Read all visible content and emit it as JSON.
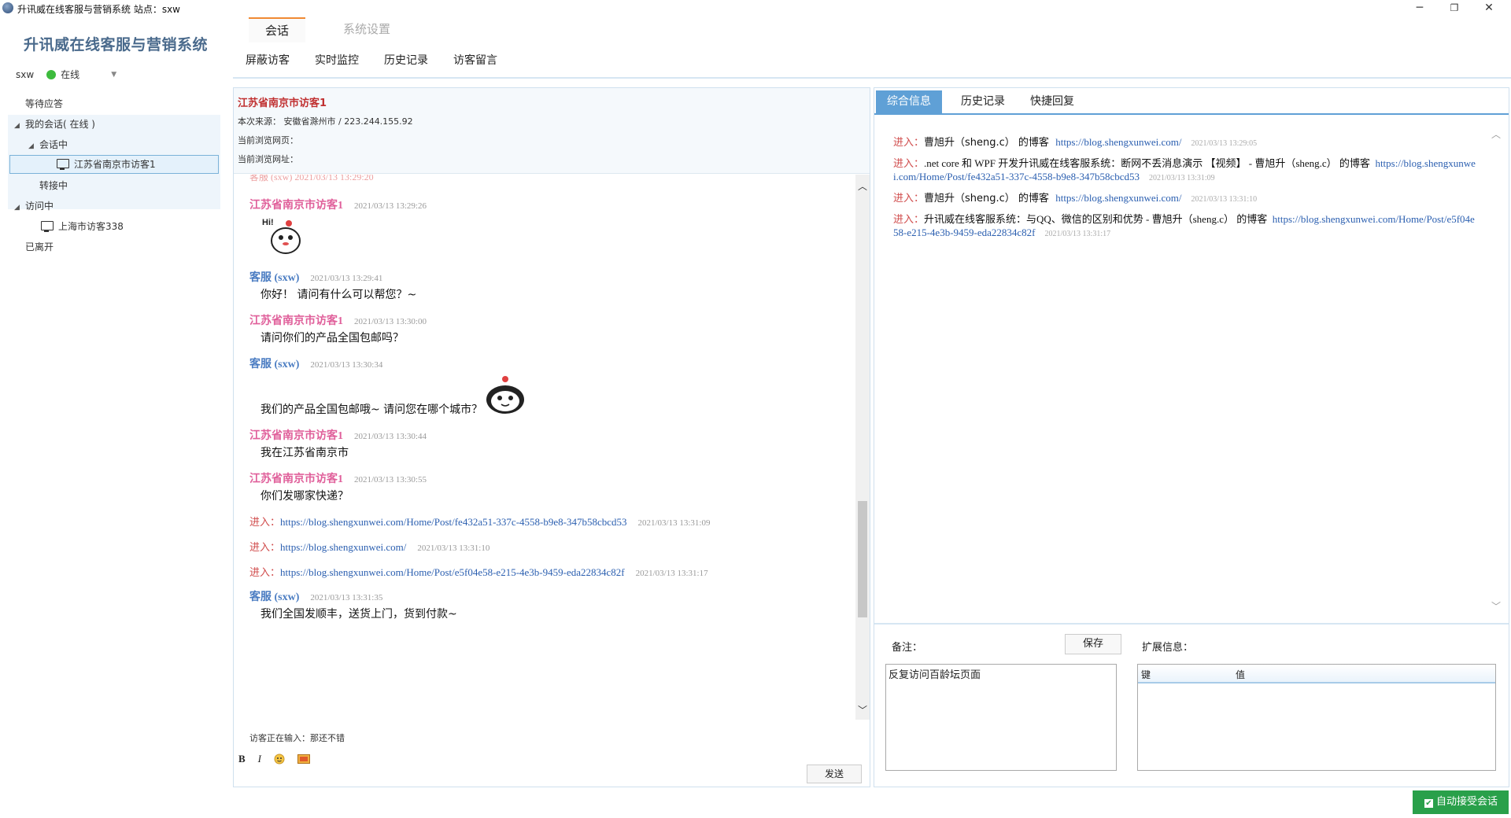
{
  "window": {
    "title": "升讯威在线客服与营销系统 站点：sxw",
    "controls": [
      "─",
      "❐",
      "✕"
    ]
  },
  "sidebar": {
    "app_name": "升讯威在线客服与营销系统",
    "user": "sxw",
    "status": "在线",
    "status_color": "#3dbb3d",
    "tree": {
      "waiting": "等待应答",
      "my_sessions": "我的会话( 在线 )",
      "in_session": "会话中",
      "active_visitor": "江苏省南京市访客1",
      "transferring": "转接中",
      "visiting": "访问中",
      "visiting_visitor": "上海市访客338",
      "left": "已离开"
    }
  },
  "top_tabs": {
    "session": "会话",
    "settings": "系统设置",
    "sub_nav": [
      "屏蔽访客",
      "实时监控",
      "历史记录",
      "访客留言"
    ]
  },
  "visitor": {
    "name": "江苏省南京市访客1",
    "source_label": "本次来源：",
    "source_value": "安徽省滁州市 / 223.244.155.92",
    "page_label": "当前浏览网页：",
    "url_label": "当前浏览网址："
  },
  "messages": {
    "partial_top": "客服 (sxw)  2021/03/13 13:29:20",
    "m1": {
      "sender": "江苏省南京市访客1",
      "time": "2021/03/13 13:29:26"
    },
    "m2": {
      "sender": "客服",
      "agent": "(sxw)",
      "time": "2021/03/13 13:29:41",
      "text": "你好！ 请问有什么可以帮您？~"
    },
    "m3": {
      "sender": "江苏省南京市访客1",
      "time": "2021/03/13 13:30:00",
      "text": "请问你们的产品全国包邮吗？"
    },
    "m4": {
      "sender": "客服",
      "agent": "(sxw)",
      "time": "2021/03/13 13:30:34",
      "text": "我们的产品全国包邮哦~ 请问您在哪个城市？"
    },
    "m5": {
      "sender": "江苏省南京市访客1",
      "time": "2021/03/13 13:30:44",
      "text": "我在江苏省南京市"
    },
    "m6": {
      "sender": "江苏省南京市访客1",
      "time": "2021/03/13 13:30:55",
      "text": "你们发哪家快递？"
    },
    "e1": {
      "label": "进入：",
      "url": "https://blog.shengxunwei.com/Home/Post/fe432a51-337c-4558-b9e8-347b58cbcd53",
      "time": "2021/03/13 13:31:09"
    },
    "e2": {
      "label": "进入：",
      "url": "https://blog.shengxunwei.com/",
      "time": "2021/03/13 13:31:10"
    },
    "e3": {
      "label": "进入：",
      "url": "https://blog.shengxunwei.com/Home/Post/e5f04e58-e215-4e3b-9459-eda22834c82f",
      "time": "2021/03/13 13:31:17"
    },
    "m7": {
      "sender": "客服",
      "agent": "(sxw)",
      "time": "2021/03/13 13:31:35",
      "text": "我们全国发顺丰，送货上门，货到付款~"
    }
  },
  "composer": {
    "typing": "访客正在输入：那还不错",
    "bold": "B",
    "italic": "I",
    "send": "发送"
  },
  "right_tabs": [
    "综合信息",
    "历史记录",
    "快捷回复"
  ],
  "visit_log": [
    {
      "label": "进入：",
      "title": "曹旭升（sheng.c） 的博客",
      "url": "https://blog.shengxunwei.com/",
      "time": "2021/03/13 13:29:05"
    },
    {
      "label": "进入：",
      "title": ".net core 和 WPF 开发升讯威在线客服系统：断网不丢消息演示 【视频】 - 曹旭升（sheng.c） 的博客",
      "url": "https://blog.shengxunwei.com/Home/Post/fe432a51-337c-4558-b9e8-347b58cbcd53",
      "time": "2021/03/13 13:31:09"
    },
    {
      "label": "进入：",
      "title": "曹旭升（sheng.c） 的博客",
      "url": "https://blog.shengxunwei.com/",
      "time": "2021/03/13 13:31:10"
    },
    {
      "label": "进入：",
      "title": "升讯威在线客服系统：与QQ、微信的区别和优势 - 曹旭升（sheng.c） 的博客",
      "url": "https://blog.shengxunwei.com/Home/Post/e5f04e58-e215-4e3b-9459-eda22834c82f",
      "time": "2021/03/13 13:31:17"
    }
  ],
  "notes": {
    "label": "备注：",
    "save": "保存",
    "content": "反复访问百龄坛页面",
    "ext_label": "扩展信息：",
    "key_col": "键",
    "value_col": "值"
  },
  "auto_accept": {
    "label": "自动接受会话",
    "checked": true,
    "color": "#29a04a"
  }
}
